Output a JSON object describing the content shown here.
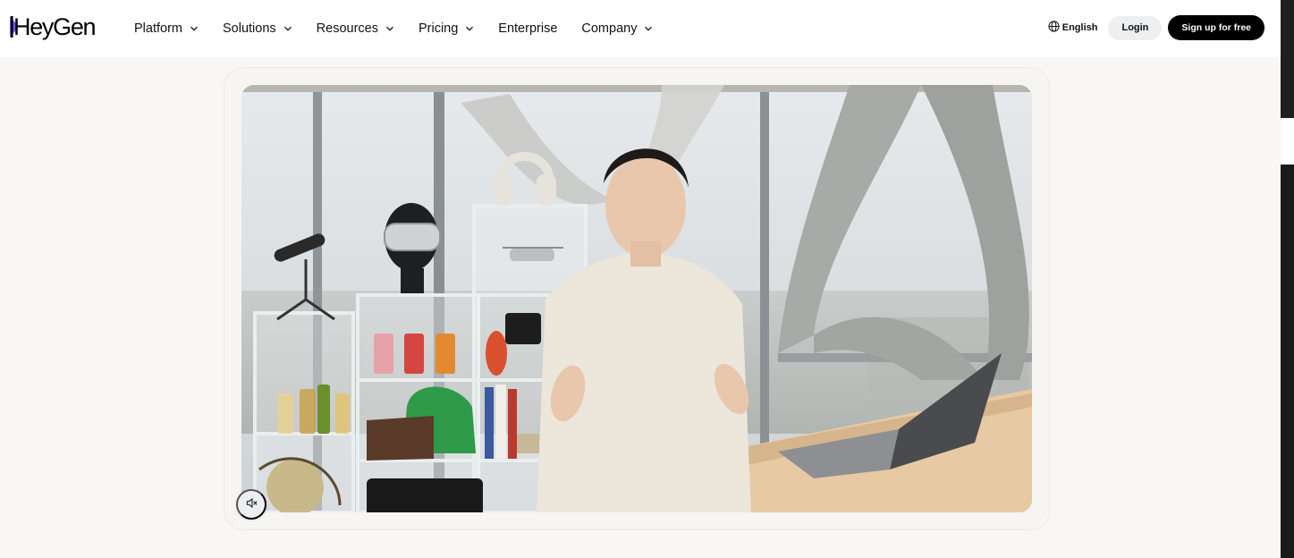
{
  "brand": {
    "logo_text": "HeyGen",
    "accent": "#7559ff"
  },
  "nav": {
    "items": [
      {
        "label": "Platform",
        "has_dropdown": true
      },
      {
        "label": "Solutions",
        "has_dropdown": true
      },
      {
        "label": "Resources",
        "has_dropdown": true
      },
      {
        "label": "Pricing",
        "has_dropdown": true
      },
      {
        "label": "Enterprise",
        "has_dropdown": false
      },
      {
        "label": "Company",
        "has_dropdown": true
      }
    ],
    "language": "English",
    "login_label": "Login",
    "signup_label": "Sign up for free"
  },
  "video": {
    "muted": true,
    "icon": "speaker-muted-icon"
  },
  "colors": {
    "page_bg": "#f8f7f4",
    "nav_bg": "#ffffff",
    "cta_bg": "#000000"
  }
}
